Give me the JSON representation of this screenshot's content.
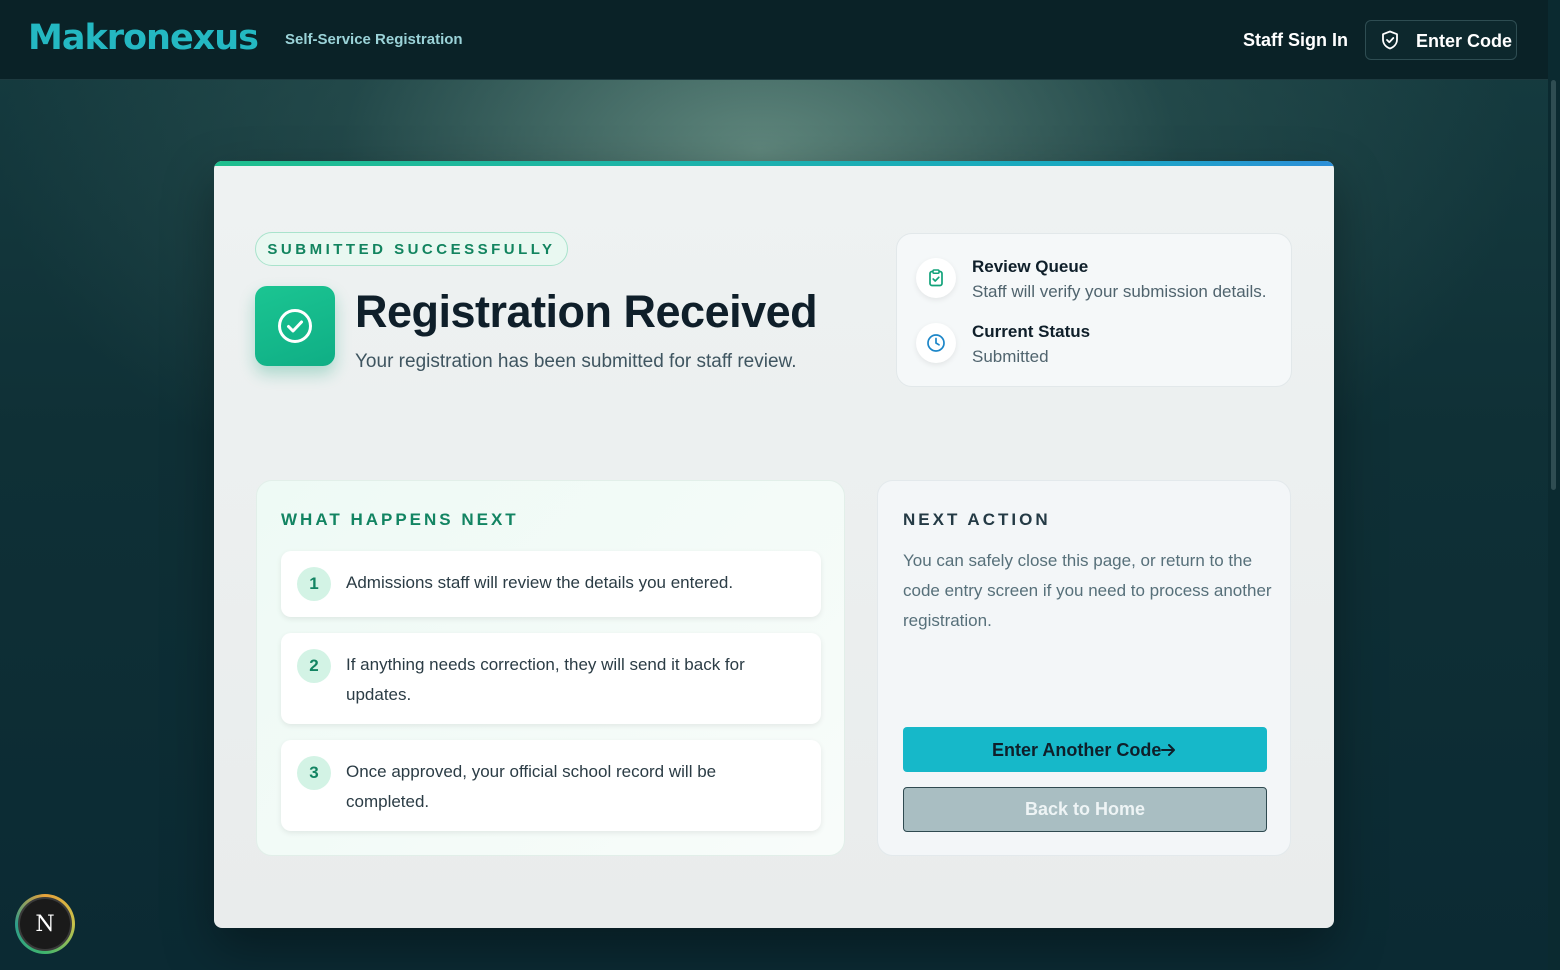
{
  "header": {
    "logo": "Makronexus",
    "subtitle": "Self-Service Registration",
    "staff_sign_in": "Staff Sign In",
    "enter_code": "Enter Code"
  },
  "hero": {
    "badge": "SUBMITTED SUCCESSFULLY",
    "title": "Registration Received",
    "subtitle": "Your registration has been submitted for staff review."
  },
  "status": {
    "queue_title": "Review Queue",
    "queue_text": "Staff will verify your submission details.",
    "current_title": "Current Status",
    "current_value": "Submitted"
  },
  "next_steps": {
    "heading": "WHAT HAPPENS NEXT",
    "items": [
      {
        "num": "1",
        "text": "Admissions staff will review the details you entered."
      },
      {
        "num": "2",
        "text": "If anything needs correction, they will send it back for updates."
      },
      {
        "num": "3",
        "text": "Once approved, your official school record will be completed."
      }
    ]
  },
  "next_action": {
    "heading": "NEXT ACTION",
    "text": "You can safely close this page, or return to the code entry screen if you need to process another registration.",
    "primary_button": "Enter Another Code",
    "secondary_button": "Back to Home"
  },
  "dev_badge": "N",
  "colors": {
    "accent": "#16b8c9",
    "success": "#12b886",
    "header_bg": "#0a2227"
  }
}
